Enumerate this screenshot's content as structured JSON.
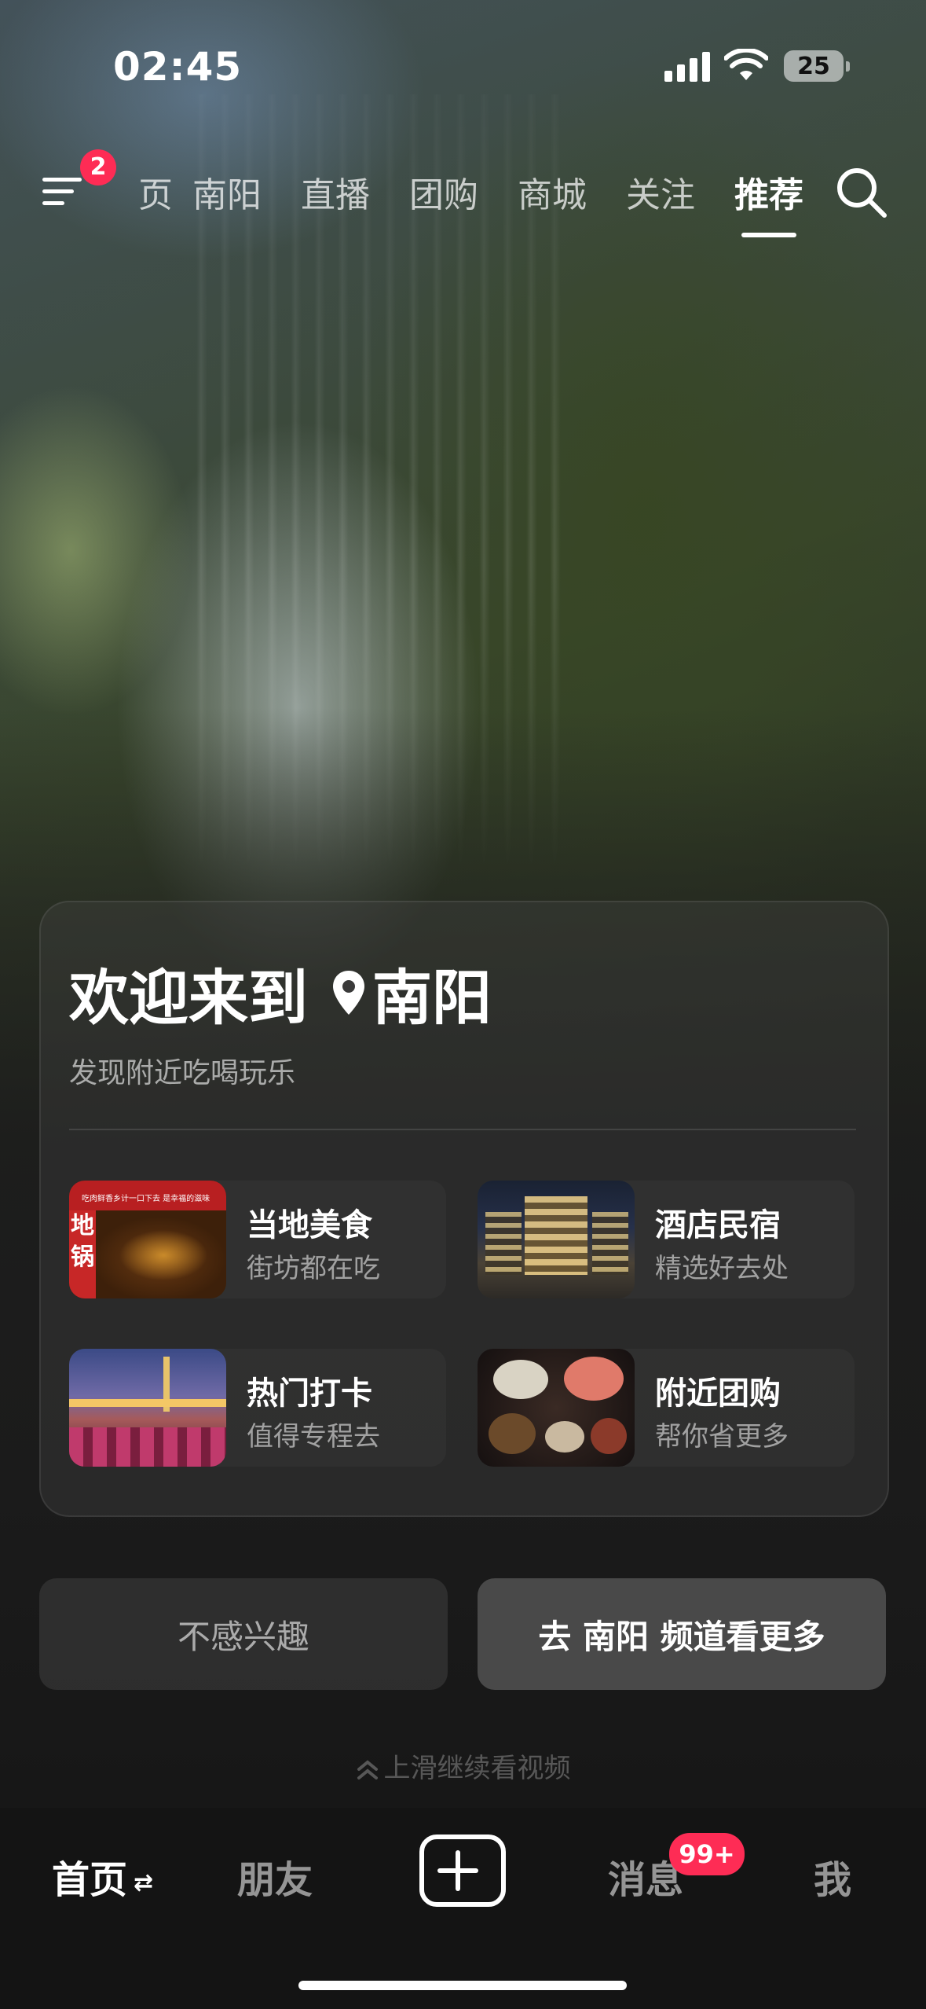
{
  "status_bar": {
    "time": "02:45",
    "battery": "25"
  },
  "top_nav": {
    "menu_badge": "2",
    "tabs": [
      {
        "label": "页"
      },
      {
        "label": "南阳"
      },
      {
        "label": "直播"
      },
      {
        "label": "团购"
      },
      {
        "label": "商城"
      },
      {
        "label": "关注"
      },
      {
        "label": "推荐"
      }
    ],
    "active_tab": "推荐"
  },
  "welcome_card": {
    "title": "欢迎来到",
    "city": "南阳",
    "subtitle": "发现附近吃喝玩乐",
    "tiles": [
      {
        "title": "当地美食",
        "subtitle": "街坊都在吃",
        "thumb_text_top": "吃肉鲜香乡计一口下去 是幸福的滋味",
        "thumb_text_side": "地锅"
      },
      {
        "title": "酒店民宿",
        "subtitle": "精选好去处"
      },
      {
        "title": "热门打卡",
        "subtitle": "值得专程去"
      },
      {
        "title": "附近团购",
        "subtitle": "帮你省更多"
      }
    ]
  },
  "actions": {
    "not_interested": "不感兴趣",
    "go_channel": "去 南阳 频道看更多"
  },
  "swipe_hint": "上滑继续看视频",
  "bottom_nav": {
    "home": "首页",
    "friends": "朋友",
    "messages": "消息",
    "messages_badge": "99+",
    "me": "我"
  },
  "colors": {
    "badge": "#fe2c55",
    "background": "#141414"
  }
}
